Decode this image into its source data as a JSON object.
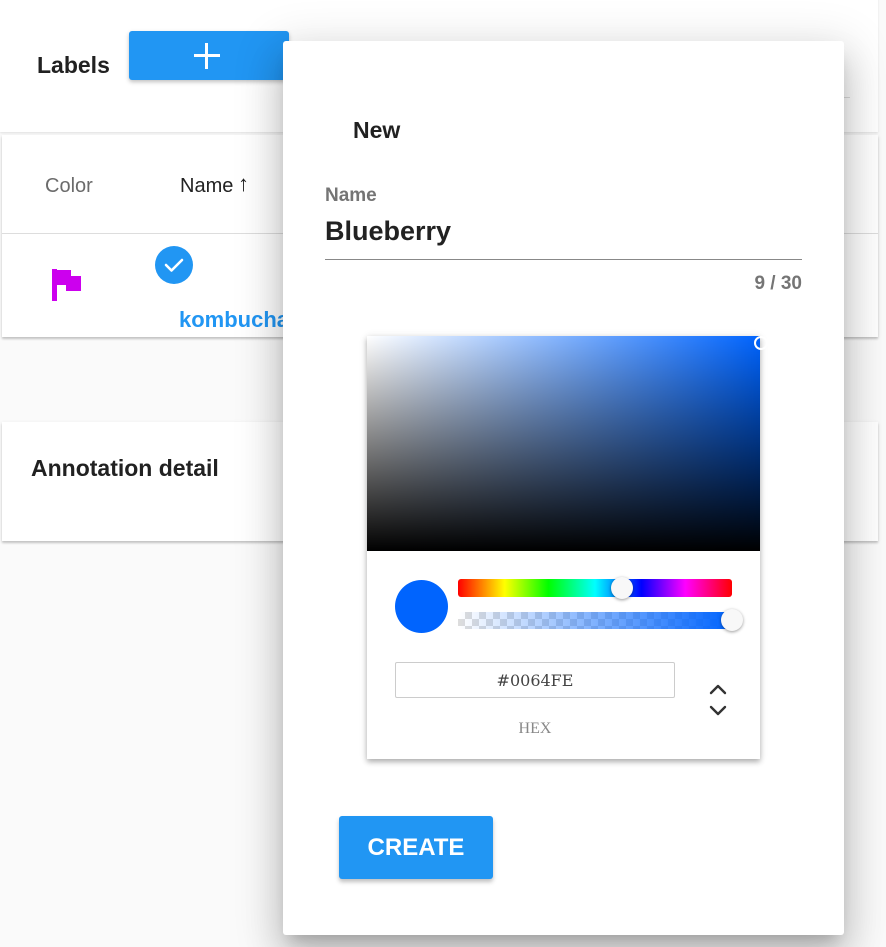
{
  "labels_panel": {
    "title": "Labels",
    "add_icon": "plus-icon"
  },
  "table": {
    "columns": [
      "Color",
      "Name"
    ],
    "sort_icon": "arrow-up-icon",
    "rows": [
      {
        "color_icon": "flag-icon",
        "color": "#cc00ee",
        "selected": true,
        "name": "kombucha"
      }
    ]
  },
  "annotation_panel": {
    "title": "Annotation detail"
  },
  "dialog": {
    "title": "New",
    "name_field": {
      "label": "Name",
      "value": "Blueberry",
      "counter": "9 / 30"
    },
    "color_picker": {
      "hex_value": "#0064FE",
      "mode_label": "HEX",
      "hue_level": 0.6,
      "alpha_level": 1.0,
      "toggle_icon": "chevron-up-down-icon"
    },
    "create_label": "CREATE"
  },
  "colors": {
    "accent": "#2196f3",
    "selected_color": "#0064FE"
  }
}
